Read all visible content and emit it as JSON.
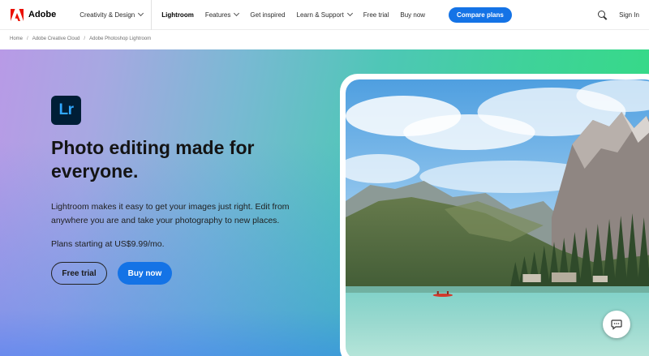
{
  "nav": {
    "brand": "Adobe",
    "items": [
      {
        "label": "Creativity & Design",
        "dropdown": true
      },
      {
        "label": "Lightroom",
        "active": true
      },
      {
        "label": "Features",
        "dropdown": true
      },
      {
        "label": "Get inspired"
      },
      {
        "label": "Learn & Support",
        "dropdown": true
      },
      {
        "label": "Free trial"
      },
      {
        "label": "Buy now"
      }
    ],
    "compare_label": "Compare plans",
    "signin_label": "Sign In",
    "icons": {
      "logo": "adobe-logo-icon",
      "search": "search-icon"
    }
  },
  "breadcrumb": [
    "Home",
    "Adobe Creative Cloud",
    "Adobe Photoshop Lightroom"
  ],
  "hero": {
    "badge": "Lr",
    "title_line1": "Photo editing made for",
    "title_line2": "everyone.",
    "desc_line1": "Lightroom makes it easy to get your images just right. Edit from",
    "desc_line2": "anywhere you are and take your photography to new places.",
    "price": "Plans starting at US$9.99/mo.",
    "free_trial_label": "Free trial",
    "buy_now_label": "Buy now"
  },
  "chat": {
    "icon": "chat-icon"
  },
  "colors": {
    "accent": "#1473e6",
    "lr_dark": "#001e36",
    "lr_blue": "#31a8ff"
  }
}
